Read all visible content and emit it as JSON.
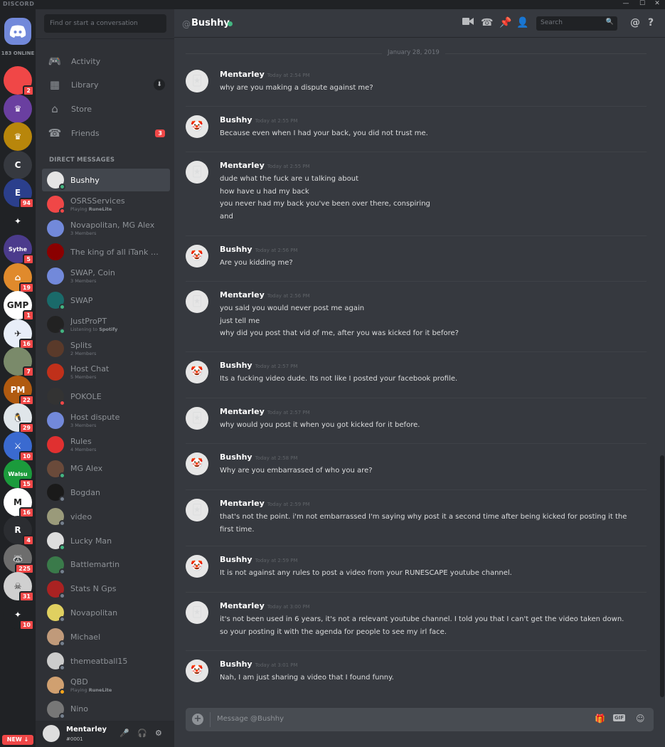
{
  "window": {
    "brand": "DISCORD",
    "controls": [
      "—",
      "☐",
      "✕"
    ]
  },
  "rail": {
    "online_count": "183 ONLINE",
    "servers": [
      {
        "name": "discord-red",
        "label": "",
        "badge": "2",
        "color": "#f04747"
      },
      {
        "name": "crown-purple",
        "label": "♛",
        "badge": "",
        "color": "#6a3fa0"
      },
      {
        "name": "crown-gold",
        "label": "♛",
        "badge": "",
        "color": "#b8860b"
      },
      {
        "name": "letter-c",
        "label": "C",
        "badge": "",
        "color": "#36393f"
      },
      {
        "name": "e-logo",
        "label": "E",
        "badge": "94",
        "color": "#2b3f8c"
      },
      {
        "name": "gems",
        "label": "✦",
        "badge": "",
        "color": "#202225"
      },
      {
        "name": "sythe",
        "label": "Sythe",
        "badge": "5",
        "color": "#4b3b8c"
      },
      {
        "name": "house",
        "label": "⌂",
        "badge": "19",
        "color": "#e08a2c"
      },
      {
        "name": "gmp",
        "label": "GMP",
        "badge": "1",
        "color": "#ffffff"
      },
      {
        "name": "wings",
        "label": "✈",
        "badge": "16",
        "color": "#e8eef8"
      },
      {
        "name": "photo",
        "label": "",
        "badge": "7",
        "color": "#7a8a6a"
      },
      {
        "name": "power-market",
        "label": "PM",
        "badge": "22",
        "color": "#b05a10"
      },
      {
        "name": "penguin",
        "label": "🐧",
        "badge": "29",
        "color": "#e0e6ea"
      },
      {
        "name": "warrior",
        "label": "⚔",
        "badge": "10",
        "color": "#3a6ad0"
      },
      {
        "name": "walsu-gold",
        "label": "Walsu",
        "badge": "15",
        "color": "#1b9b3c"
      },
      {
        "name": "m-logo",
        "label": "M",
        "badge": "16",
        "color": "#ffffff"
      },
      {
        "name": "r-logo",
        "label": "R",
        "badge": "4",
        "color": "#2b2d31"
      },
      {
        "name": "raccoon",
        "label": "🦝",
        "badge": "225",
        "color": "#6d6d6d"
      },
      {
        "name": "plague",
        "label": "☠",
        "badge": "31",
        "color": "#d0d0d0"
      },
      {
        "name": "runner",
        "label": "✦",
        "badge": "10",
        "color": "#202225"
      }
    ],
    "new_label": "NEW ↓"
  },
  "dm_sidebar": {
    "search_placeholder": "Find or start a conversation",
    "nav": [
      {
        "id": "activity",
        "label": "Activity",
        "icon": "🎮"
      },
      {
        "id": "library",
        "label": "Library",
        "icon": "▦"
      },
      {
        "id": "store",
        "label": "Store",
        "icon": "⌂"
      },
      {
        "id": "friends",
        "label": "Friends",
        "icon": "☎",
        "badge": "3"
      }
    ],
    "header": "DIRECT MESSAGES",
    "dms": [
      {
        "name": "Bushhy",
        "sub": "",
        "status": "online",
        "color": "#e5e5e5",
        "active": true
      },
      {
        "name": "OSRSServices",
        "sub": "Playing",
        "sub_bold": "RuneLite",
        "status": "dnd",
        "color": "#f04747"
      },
      {
        "name": "Novapolitan, MG Alex",
        "sub": "3 Members",
        "status": "",
        "color": "#7289da"
      },
      {
        "name": "The king of all iTank Pe...",
        "sub": "",
        "status": "",
        "color": "#8a0000"
      },
      {
        "name": "SWAP, Coin",
        "sub": "3 Members",
        "status": "",
        "color": "#7289da"
      },
      {
        "name": "SWAP",
        "sub": "",
        "status": "online",
        "color": "#1a6a6a"
      },
      {
        "name": "JustProPT",
        "sub": "Listening to",
        "sub_bold": "Spotify",
        "status": "online",
        "color": "#222222"
      },
      {
        "name": "Splits",
        "sub": "2 Members",
        "status": "",
        "color": "#5a3a2a"
      },
      {
        "name": "Host Chat",
        "sub": "5 Members",
        "status": "",
        "color": "#c0301a"
      },
      {
        "name": "POKOLE",
        "sub": "",
        "status": "dnd",
        "color": "#333333"
      },
      {
        "name": "Host dispute",
        "sub": "3 Members",
        "status": "",
        "color": "#7289da"
      },
      {
        "name": "Rules",
        "sub": "4 Members",
        "status": "",
        "color": "#e03030"
      },
      {
        "name": "MG Alex",
        "sub": "",
        "status": "online",
        "color": "#6a4a3a"
      },
      {
        "name": "Bogdan",
        "sub": "",
        "status": "off",
        "color": "#1a1a1a"
      },
      {
        "name": "video",
        "sub": "",
        "status": "off",
        "color": "#9a9a7a"
      },
      {
        "name": "Lucky Man",
        "sub": "",
        "status": "online",
        "color": "#dddddd"
      },
      {
        "name": "Battlemartin",
        "sub": "",
        "status": "off",
        "color": "#3a7a4a"
      },
      {
        "name": "Stats N Gps",
        "sub": "",
        "status": "off",
        "color": "#aa2222"
      },
      {
        "name": "Novapolitan",
        "sub": "",
        "status": "off",
        "color": "#e0d060"
      },
      {
        "name": "Michael",
        "sub": "",
        "status": "off",
        "color": "#c09a7a"
      },
      {
        "name": "themeatball15",
        "sub": "",
        "status": "off",
        "color": "#cccccc"
      },
      {
        "name": "QBD",
        "sub": "Playing",
        "sub_bold": "RuneLite",
        "status": "idle",
        "color": "#d0a070"
      },
      {
        "name": "Nino",
        "sub": "",
        "status": "off",
        "color": "#777777"
      }
    ]
  },
  "user_panel": {
    "name": "Mentarley",
    "tag": "#0001"
  },
  "chat": {
    "at": "@",
    "title": "Bushhy",
    "search_placeholder": "Search",
    "date": "January 28, 2019",
    "composer_placeholder": "Message @Bushhy",
    "messages": [
      {
        "author": "Mentarley",
        "time": "Today at 2:54 PM",
        "lines": [
          "why are you making a dispute against me?"
        ]
      },
      {
        "author": "Bushhy",
        "time": "Today at 2:55 PM",
        "lines": [
          "Because even when I had your back, you did not trust me."
        ]
      },
      {
        "author": "Mentarley",
        "time": "Today at 2:55 PM",
        "lines": [
          "dude what the fuck are u talking about",
          "how have u had my back",
          "you never had my back you've been over there, conspiring",
          "and"
        ]
      },
      {
        "author": "Bushhy",
        "time": "Today at 2:56 PM",
        "lines": [
          "Are you kidding me?"
        ]
      },
      {
        "author": "Mentarley",
        "time": "Today at 2:56 PM",
        "lines": [
          "you said you would never post me again",
          "just tell me",
          "why did you post that vid of me, after you was kicked for it before?"
        ]
      },
      {
        "author": "Bushhy",
        "time": "Today at 2:57 PM",
        "lines": [
          "Its a fucking video dude. Its not like I posted your facebook profile."
        ]
      },
      {
        "author": "Mentarley",
        "time": "Today at 2:57 PM",
        "lines": [
          "why would you post it when you got kicked for it before."
        ]
      },
      {
        "author": "Bushhy",
        "time": "Today at 2:58 PM",
        "lines": [
          "Why are you embarrassed of who you are?"
        ]
      },
      {
        "author": "Mentarley",
        "time": "Today at 2:59 PM",
        "lines": [
          "that's not the point. i'm not embarrassed I'm saying why post it a second time after being kicked for posting it the",
          "first time."
        ]
      },
      {
        "author": "Bushhy",
        "time": "Today at 2:59 PM",
        "lines": [
          "It is not against any rules to post a video from your RUNESCAPE youtube channel."
        ]
      },
      {
        "author": "Mentarley",
        "time": "Today at 3:00 PM",
        "lines": [
          "it's not been used in 6 years, it's not a relevant youtube channel. I told you that I can't get the video taken down.",
          "so your posting it with the agenda for people to see my irl face."
        ]
      },
      {
        "author": "Bushhy",
        "time": "Today at 3:01 PM",
        "lines": [
          "Nah, I am just sharing a video that I found funny."
        ]
      }
    ]
  }
}
